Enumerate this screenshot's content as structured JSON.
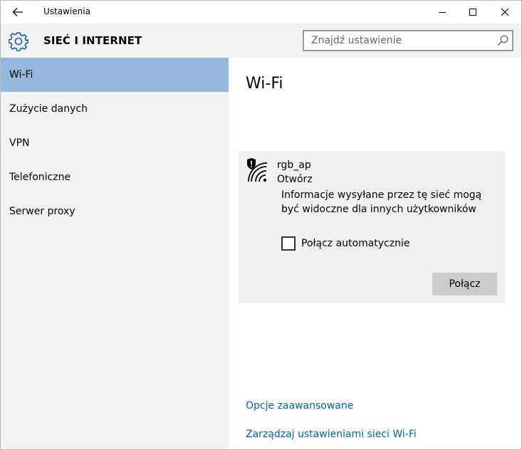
{
  "window": {
    "title": "Ustawienia",
    "back_icon": "arrow-left-icon",
    "minimize_icon": "minimize-icon",
    "maximize_icon": "maximize-icon",
    "close_icon": "close-icon"
  },
  "header": {
    "icon": "gear-icon",
    "title": "SIEĆ I INTERNET",
    "search_placeholder": "Znajdź ustawienie",
    "search_icon": "search-icon"
  },
  "sidebar": {
    "items": [
      {
        "label": "Wi-Fi",
        "active": true
      },
      {
        "label": "Zużycie danych",
        "active": false
      },
      {
        "label": "VPN",
        "active": false
      },
      {
        "label": "Telefoniczne",
        "active": false
      },
      {
        "label": "Serwer proxy",
        "active": false
      }
    ],
    "active_color": "#93b8db"
  },
  "main": {
    "page_title": "Wi-Fi",
    "network": {
      "icon": "wifi-shield-warning-icon",
      "name": "rgb_ap",
      "status": "Otwórz",
      "warning": "Informacje wysyłane przez tę sieć mogą być widoczne dla innych użytkowników",
      "auto_connect_label": "Połącz automatycznie",
      "auto_connect_checked": false,
      "connect_label": "Połącz"
    },
    "links": {
      "advanced": "Opcje zaawansowane",
      "manage": "Zarządzaj ustawieniami sieci Wi-Fi"
    },
    "link_color": "#0063b1"
  }
}
